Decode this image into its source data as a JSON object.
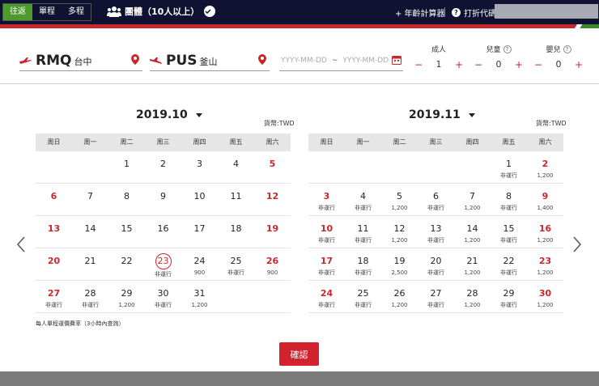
{
  "trip_tabs": [
    {
      "label": "往返",
      "active": true
    },
    {
      "label": "單程",
      "active": false
    },
    {
      "label": "多程",
      "active": false
    }
  ],
  "group_label": "團體（10人以上）",
  "age_calculator": "+ 年齡計算器",
  "discount_code": "打折代碼",
  "origin": {
    "code": "RMQ",
    "city": "台中"
  },
  "destination": {
    "code": "PUS",
    "city": "釜山"
  },
  "dates": {
    "depart_placeholder": "YYYY-MM-DD",
    "separator": "~",
    "return_placeholder": "YYYY-MM-DD"
  },
  "passengers": [
    {
      "label": "成人",
      "count": "1",
      "help": false
    },
    {
      "label": "兒童",
      "count": "0",
      "help": true
    },
    {
      "label": "嬰兒",
      "count": "0",
      "help": true
    }
  ],
  "weekdays": [
    "周日",
    "周一",
    "周二",
    "周三",
    "周四",
    "周五",
    "周六"
  ],
  "months": [
    {
      "title": "2019.10",
      "currency": "貨幣:TWD",
      "weeks": [
        [
          {
            "d": ""
          },
          {
            "d": ""
          },
          {
            "d": "1"
          },
          {
            "d": "2"
          },
          {
            "d": "3"
          },
          {
            "d": "4"
          },
          {
            "d": "5",
            "red": true
          }
        ],
        [
          {
            "d": "6",
            "red": true
          },
          {
            "d": "7"
          },
          {
            "d": "8"
          },
          {
            "d": "9"
          },
          {
            "d": "10"
          },
          {
            "d": "11"
          },
          {
            "d": "12",
            "red": true
          }
        ],
        [
          {
            "d": "13",
            "red": true
          },
          {
            "d": "14"
          },
          {
            "d": "15"
          },
          {
            "d": "16"
          },
          {
            "d": "17"
          },
          {
            "d": "18"
          },
          {
            "d": "19",
            "red": true
          }
        ],
        [
          {
            "d": "20",
            "red": true
          },
          {
            "d": "21"
          },
          {
            "d": "22"
          },
          {
            "d": "23",
            "today": true,
            "s": "非運行"
          },
          {
            "d": "24",
            "s": "900"
          },
          {
            "d": "25",
            "s": "非運行"
          },
          {
            "d": "26",
            "red": true,
            "s": "900"
          }
        ],
        [
          {
            "d": "27",
            "red": true,
            "s": "非運行"
          },
          {
            "d": "28",
            "s": "非運行"
          },
          {
            "d": "29",
            "s": "1,200"
          },
          {
            "d": "30",
            "s": "非運行"
          },
          {
            "d": "31",
            "s": "1,200"
          },
          {
            "d": ""
          },
          {
            "d": ""
          }
        ]
      ]
    },
    {
      "title": "2019.11",
      "currency": "貨幣:TWD",
      "weeks": [
        [
          {
            "d": ""
          },
          {
            "d": ""
          },
          {
            "d": ""
          },
          {
            "d": ""
          },
          {
            "d": ""
          },
          {
            "d": "1",
            "s": "非運行"
          },
          {
            "d": "2",
            "red": true,
            "s": "1,200"
          }
        ],
        [
          {
            "d": "3",
            "red": true,
            "s": "非運行"
          },
          {
            "d": "4",
            "s": "非運行"
          },
          {
            "d": "5",
            "s": "1,200"
          },
          {
            "d": "6",
            "s": "非運行"
          },
          {
            "d": "7",
            "s": "1,200"
          },
          {
            "d": "8",
            "s": "非運行"
          },
          {
            "d": "9",
            "red": true,
            "s": "1,400"
          }
        ],
        [
          {
            "d": "10",
            "red": true,
            "s": "非運行"
          },
          {
            "d": "11",
            "s": "非運行"
          },
          {
            "d": "12",
            "s": "1,200"
          },
          {
            "d": "13",
            "s": "非運行"
          },
          {
            "d": "14",
            "s": "1,200"
          },
          {
            "d": "15",
            "s": "非運行"
          },
          {
            "d": "16",
            "red": true,
            "s": "1,200"
          }
        ],
        [
          {
            "d": "17",
            "red": true,
            "s": "非運行"
          },
          {
            "d": "18",
            "s": "非運行"
          },
          {
            "d": "19",
            "s": "2,500"
          },
          {
            "d": "20",
            "s": "非運行"
          },
          {
            "d": "21",
            "s": "1,200"
          },
          {
            "d": "22",
            "s": "非運行"
          },
          {
            "d": "23",
            "red": true,
            "s": "1,200"
          }
        ],
        [
          {
            "d": "24",
            "red": true,
            "s": "非運行"
          },
          {
            "d": "25",
            "s": "非運行"
          },
          {
            "d": "26",
            "s": "1,200"
          },
          {
            "d": "27",
            "s": "非運行"
          },
          {
            "d": "28",
            "s": "1,200"
          },
          {
            "d": "29",
            "s": "非運行"
          },
          {
            "d": "30",
            "red": true,
            "s": "1,200"
          }
        ]
      ]
    }
  ],
  "footnote": "每人單程運價費率（3小時內查詢）",
  "confirm_label": "確認",
  "colors": {
    "brand_red": "#c8282c",
    "topbar": "#0f1230",
    "active_tab": "#4d9b2a"
  }
}
